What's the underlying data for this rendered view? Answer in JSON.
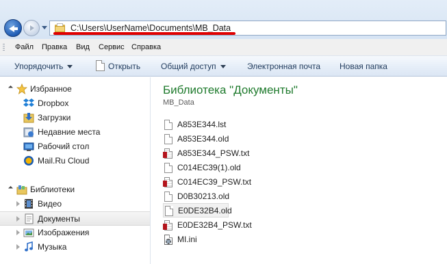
{
  "address_bar": {
    "path": "C:\\Users\\UserName\\Documents\\MB_Data"
  },
  "menu": {
    "items": [
      "Файл",
      "Правка",
      "Вид",
      "Сервис",
      "Справка"
    ]
  },
  "toolbar": {
    "organize": "Упорядочить",
    "open": "Открыть",
    "share": "Общий доступ",
    "email": "Электронная почта",
    "new_folder": "Новая папка"
  },
  "nav": {
    "favorites": {
      "label": "Избранное",
      "items": [
        {
          "label": "Dropbox",
          "icon": "dropbox-icon"
        },
        {
          "label": "Загрузки",
          "icon": "downloads-icon"
        },
        {
          "label": "Недавние места",
          "icon": "recent-places-icon"
        },
        {
          "label": "Рабочий стол",
          "icon": "desktop-icon"
        },
        {
          "label": "Mail.Ru Cloud",
          "icon": "mailru-cloud-icon"
        }
      ]
    },
    "libraries": {
      "label": "Библиотеки",
      "items": [
        {
          "label": "Видео",
          "icon": "video-library-icon"
        },
        {
          "label": "Документы",
          "icon": "documents-library-icon",
          "selected": true
        },
        {
          "label": "Изображения",
          "icon": "pictures-library-icon"
        },
        {
          "label": "Музыка",
          "icon": "music-library-icon"
        }
      ]
    }
  },
  "main": {
    "library_title": "Библиотека \"Документы\"",
    "subtitle": "MB_Data",
    "files": [
      {
        "name": "A853E344.lst",
        "type": "generic"
      },
      {
        "name": "A853E344.old",
        "type": "generic"
      },
      {
        "name": "A853E344_PSW.txt",
        "type": "txt"
      },
      {
        "name": "C014EC39(1).old",
        "type": "generic"
      },
      {
        "name": "C014EC39_PSW.txt",
        "type": "txt"
      },
      {
        "name": "D0B30213.old",
        "type": "generic"
      },
      {
        "name": "E0DE32B4.old",
        "type": "generic",
        "selected": true
      },
      {
        "name": "E0DE32B4_PSW.txt",
        "type": "txt"
      },
      {
        "name": "MI.ini",
        "type": "ini"
      }
    ]
  },
  "colors": {
    "library_title": "#1e7a2c",
    "highlight_underline": "#e00000",
    "toolbar_text": "#1e395b"
  }
}
